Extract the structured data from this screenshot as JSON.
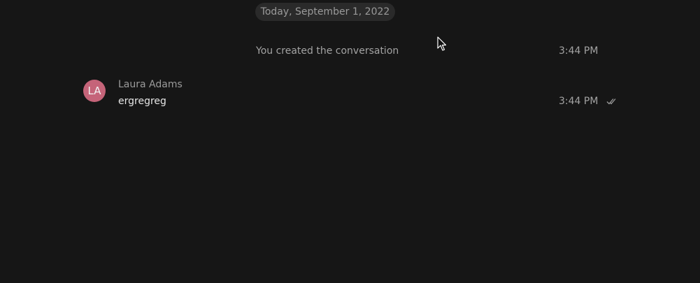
{
  "conversation": {
    "date_separator": "Today, September 1, 2022",
    "system_event": {
      "text": "You created the conversation",
      "time": "3:44 PM"
    },
    "messages": [
      {
        "sender": "Laura Adams",
        "avatar_initials": "LA",
        "avatar_color": "#c56479",
        "text": "ergregreg",
        "time": "3:44 PM",
        "status_icon": "double-check-icon"
      }
    ]
  },
  "colors": {
    "background": "#161616",
    "pill_background": "#2a2a2a",
    "muted_text": "#a3a3a3",
    "message_text": "#e6e6e6"
  }
}
